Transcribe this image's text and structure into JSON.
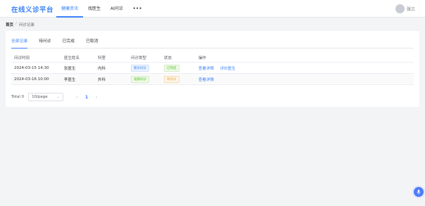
{
  "app": {
    "title": "在线义诊平台"
  },
  "nav": {
    "items": [
      {
        "label": "健康资讯",
        "active": true
      },
      {
        "label": "找医生",
        "active": false
      },
      {
        "label": "AI问诊",
        "active": false
      }
    ],
    "more_label": "•••"
  },
  "user": {
    "name": "张三"
  },
  "breadcrumb": {
    "home": "首页",
    "separator": "/",
    "current": "问诊记录"
  },
  "tabs": [
    {
      "label": "全部记录",
      "active": true
    },
    {
      "label": "待问诊",
      "active": false
    },
    {
      "label": "已完成",
      "active": false
    },
    {
      "label": "已取消",
      "active": false
    }
  ],
  "table": {
    "headers": [
      "问诊时间",
      "医生姓名",
      "科室",
      "问诊类型",
      "状态",
      "操作"
    ],
    "rows": [
      {
        "time": "2024-03-15 14:30",
        "doctor": "张医生",
        "dept": "内科",
        "type": "图文问诊",
        "type_color": "blue",
        "status": "已完成",
        "status_color": "green",
        "actions": [
          "查看详情",
          "评价医生"
        ]
      },
      {
        "time": "2024-03-16 10:00",
        "doctor": "李医生",
        "dept": "外科",
        "type": "视频问诊",
        "type_color": "green",
        "status": "待问诊",
        "status_color": "orange",
        "actions": [
          "查看详情"
        ]
      }
    ]
  },
  "pagination": {
    "total_label": "Total 0",
    "page_size": "10/page",
    "prev": "‹",
    "current_page": "1",
    "next": "›"
  },
  "colors": {
    "accent": "#3b82f6",
    "background": "#f3f4f6"
  },
  "fab": {
    "icon": "microphone-icon"
  }
}
